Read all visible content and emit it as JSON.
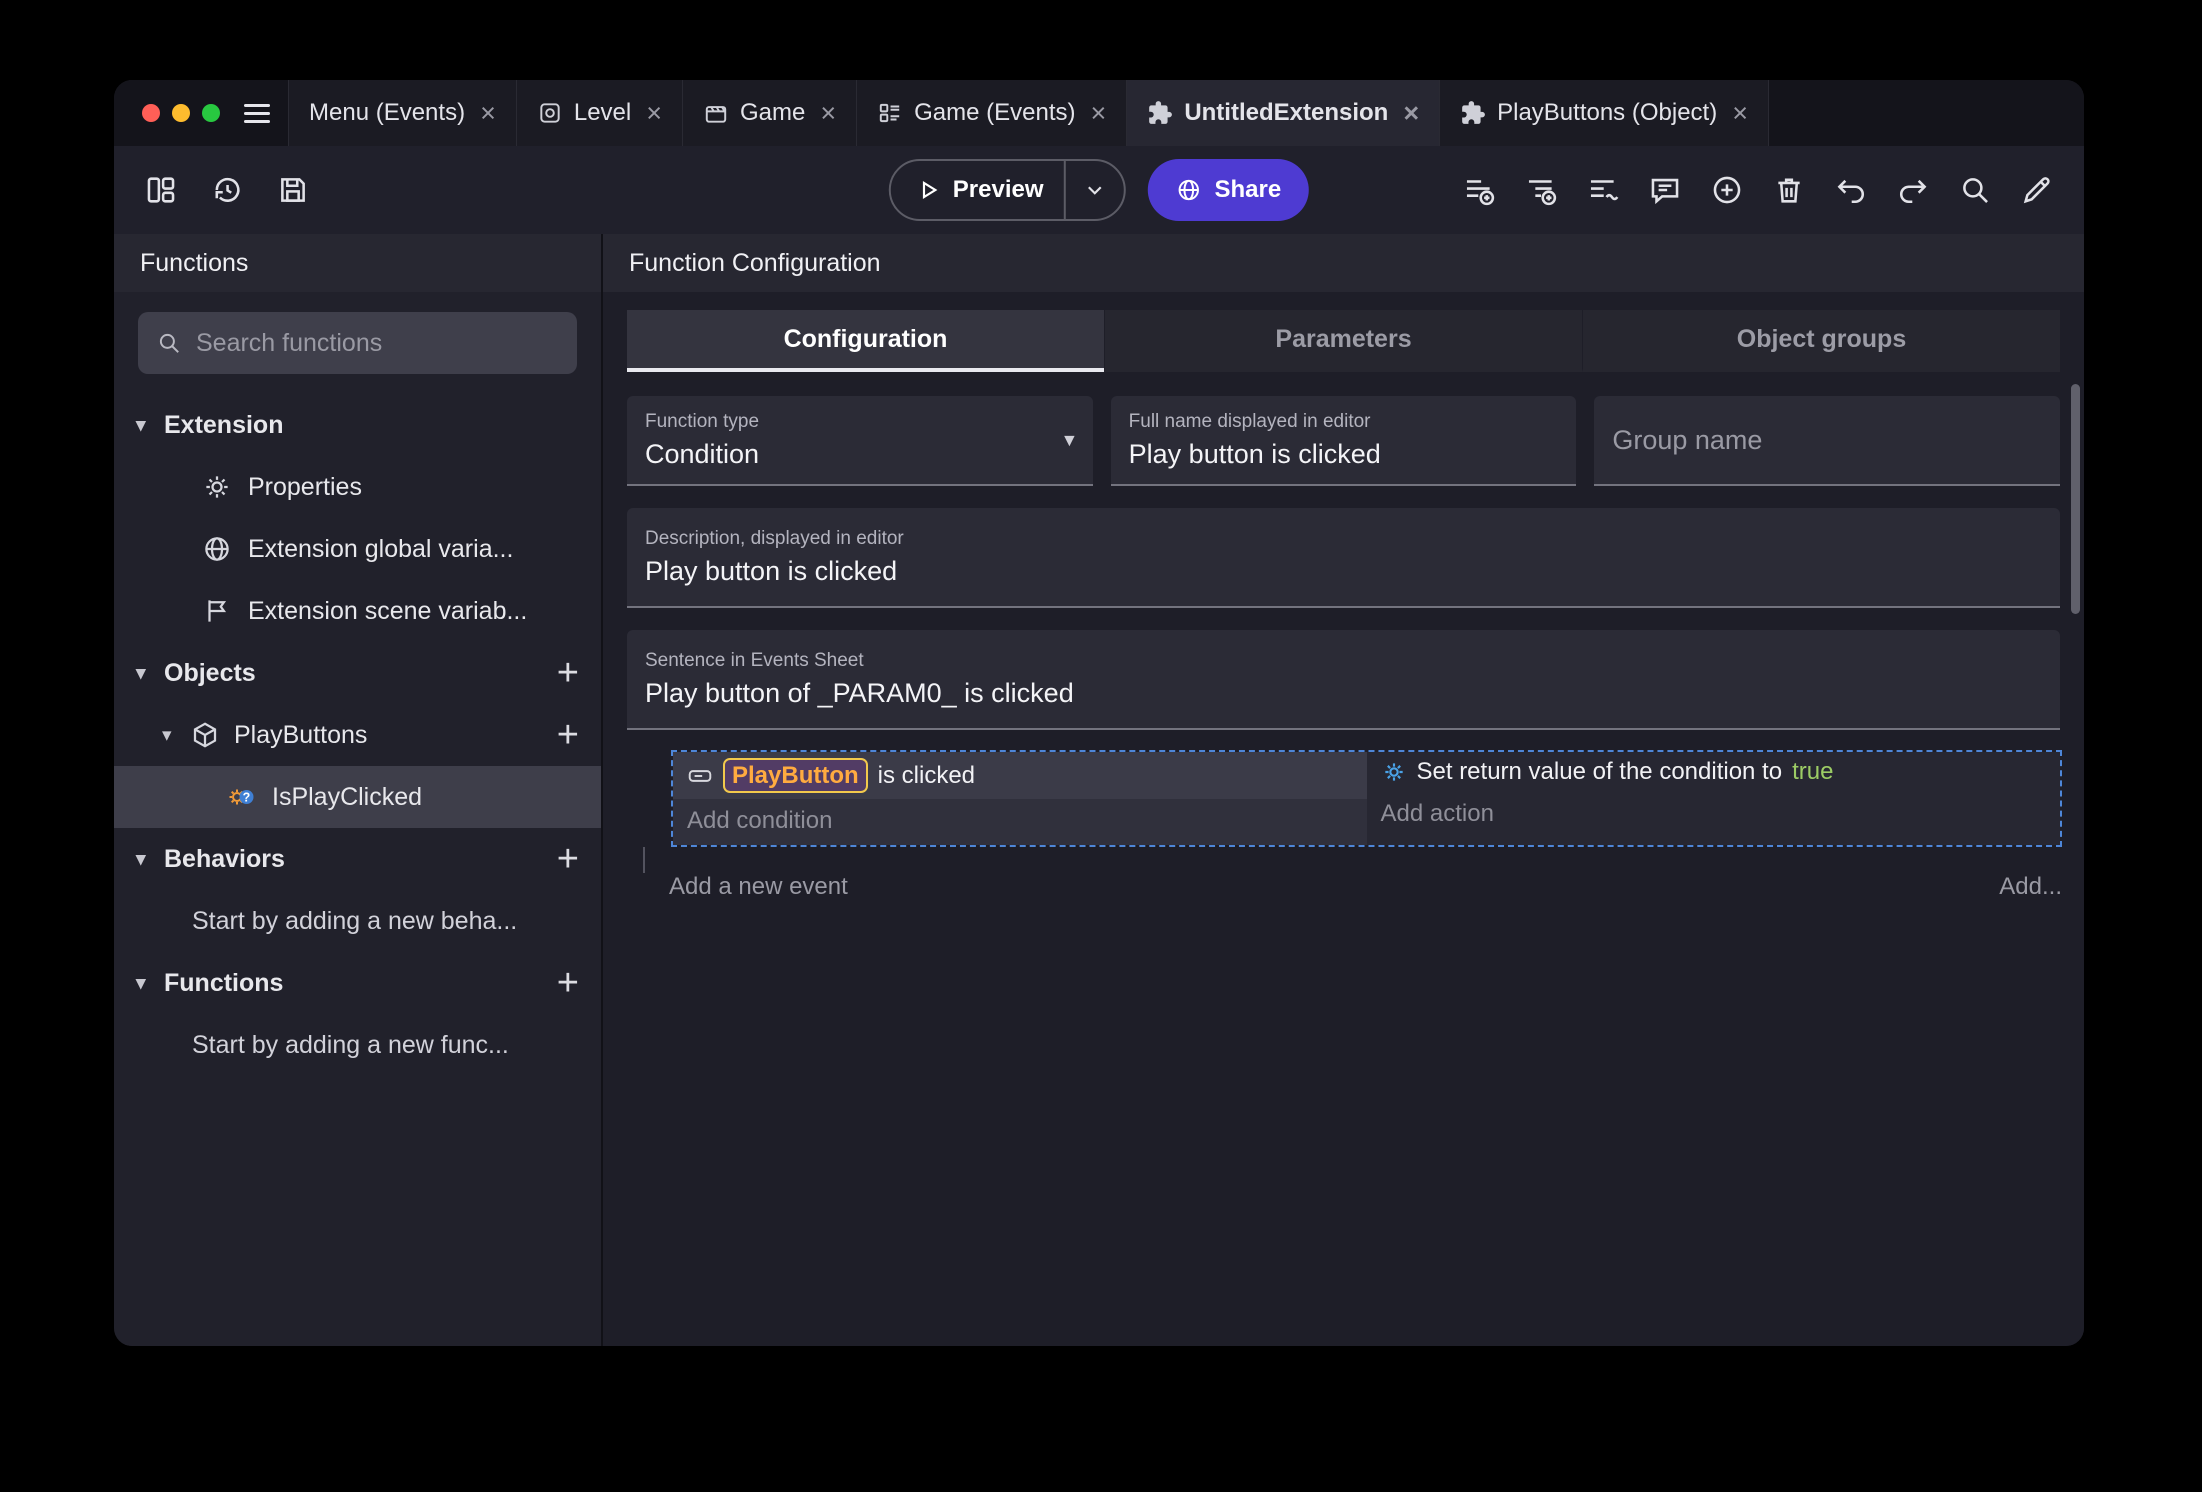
{
  "icons": {
    "close": "×",
    "chevron_down": "▾",
    "plus": "+",
    "caret_down": "▾"
  },
  "titlebar": {
    "tabs": [
      {
        "label": "Menu (Events)"
      },
      {
        "label": "Level"
      },
      {
        "label": "Game"
      },
      {
        "label": "Game (Events)"
      },
      {
        "label": "UntitledExtension"
      },
      {
        "label": "PlayButtons (Object)"
      }
    ]
  },
  "toolbar": {
    "preview_label": "Preview",
    "share_label": "Share"
  },
  "sidebar": {
    "title": "Functions",
    "search_placeholder": "Search functions",
    "items": {
      "extension": "Extension",
      "properties": "Properties",
      "global_vars": "Extension global varia...",
      "scene_vars": "Extension scene variab...",
      "objects": "Objects",
      "playbuttons": "PlayButtons",
      "isplayclicked": "IsPlayClicked",
      "behaviors": "Behaviors",
      "behaviors_hint": "Start by adding a new beha...",
      "functions": "Functions",
      "functions_hint": "Start by adding a new func..."
    }
  },
  "main": {
    "title": "Function Configuration",
    "tabs": [
      {
        "label": "Configuration"
      },
      {
        "label": "Parameters"
      },
      {
        "label": "Object groups"
      }
    ],
    "fields": {
      "function_type_label": "Function type",
      "function_type_value": "Condition",
      "full_name_label": "Full name displayed in editor",
      "full_name_value": "Play button is clicked",
      "group_name_placeholder": "Group name",
      "description_label": "Description, displayed in editor",
      "description_value": "Play button is clicked",
      "sentence_label": "Sentence in Events Sheet",
      "sentence_value": "Play button of _PARAM0_ is clicked"
    },
    "events": {
      "condition_object": "PlayButton",
      "condition_text": "is clicked",
      "add_condition": "Add condition",
      "action_text": "Set return value of the condition to",
      "action_value": "true",
      "add_action": "Add action",
      "add_new_event": "Add a new event",
      "add_more": "Add..."
    }
  },
  "colors": {
    "accent_purple": "#4E3BD2",
    "object_chip_text": "#FFAB40",
    "object_chip_border": "#F2C94C",
    "boolean_true": "#9CCC65",
    "selection_border": "#4E86D8"
  }
}
